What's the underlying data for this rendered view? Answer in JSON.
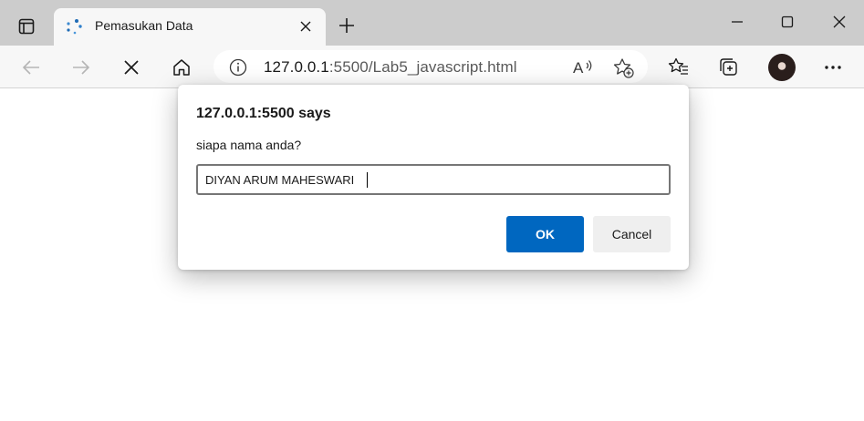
{
  "browser": {
    "tab": {
      "title": "Pemasukan Data"
    },
    "address": {
      "host": "127.0.0.1",
      "rest": ":5500/Lab5_javascript.html"
    }
  },
  "dialog": {
    "title": "127.0.0.1:5500 says",
    "message": "siapa nama anda?",
    "input_value": "DIYAN ARUM MAHESWARI",
    "ok_label": "OK",
    "cancel_label": "Cancel"
  },
  "colors": {
    "tabstrip": "#cccccc",
    "toolbar": "#f7f7f7",
    "accent": "#0067c0",
    "cancel_bg": "#efefef"
  }
}
